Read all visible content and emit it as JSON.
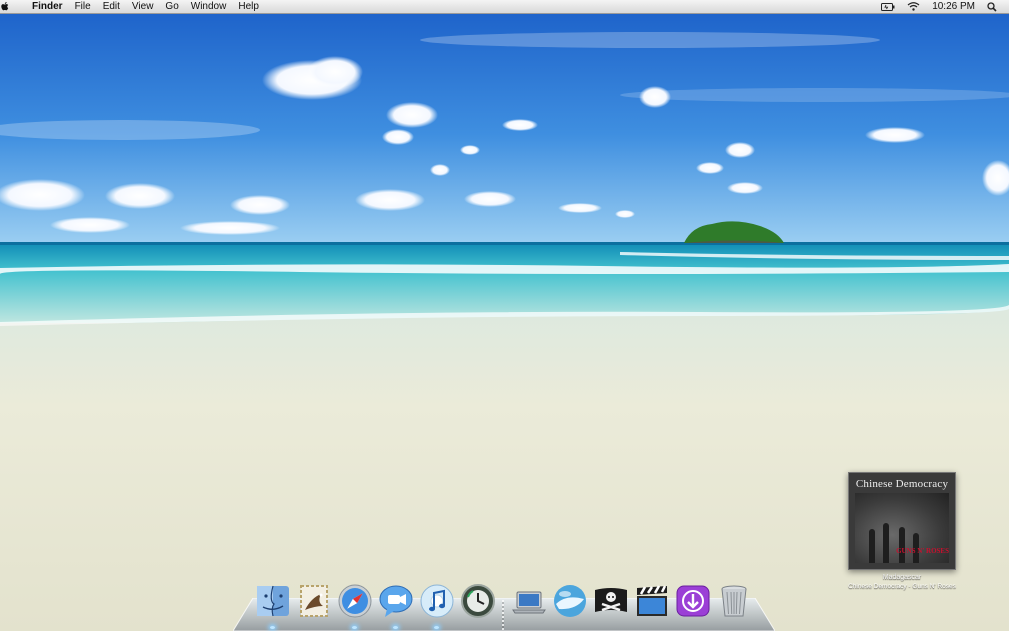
{
  "menubar": {
    "apple_glyph": "",
    "app_name": "Finder",
    "menus": [
      "File",
      "Edit",
      "View",
      "Go",
      "Window",
      "Help"
    ],
    "clock": "10:26 PM",
    "status_icons": [
      "battery-icon",
      "wifi-icon",
      "spotlight-icon"
    ]
  },
  "now_playing": {
    "album_title": "Chinese Democracy",
    "track": "Madagascar",
    "artist_line": "Chinese Democracy - Guns N' Roses",
    "cover_text": "GUNS N' ROSES"
  },
  "dock": {
    "apps": [
      {
        "name": "Finder",
        "icon": "finder-icon",
        "running": true
      },
      {
        "name": "Mail",
        "icon": "mail-icon",
        "running": false
      },
      {
        "name": "Safari",
        "icon": "safari-icon",
        "running": true
      },
      {
        "name": "iChat",
        "icon": "ichat-icon",
        "running": true
      },
      {
        "name": "iTunes",
        "icon": "itunes-icon",
        "running": true
      },
      {
        "name": "Time Machine",
        "icon": "time-machine-icon",
        "running": false
      }
    ],
    "stacks": [
      {
        "name": "MacBook",
        "icon": "laptop-icon"
      },
      {
        "name": "Globe",
        "icon": "globe-icon"
      },
      {
        "name": "Pirate Flag",
        "icon": "pirate-flag-icon"
      },
      {
        "name": "Movie Clapper",
        "icon": "clapper-icon"
      },
      {
        "name": "Downloads",
        "icon": "downloads-icon"
      },
      {
        "name": "Trash",
        "icon": "trash-icon"
      }
    ]
  },
  "colors": {
    "sky_top": "#1a63c9",
    "sky_horizon": "#7fc0ee",
    "sea": "#3fb2c8",
    "sand": "#e9ead8",
    "accent_download": "#9b3fd6"
  }
}
